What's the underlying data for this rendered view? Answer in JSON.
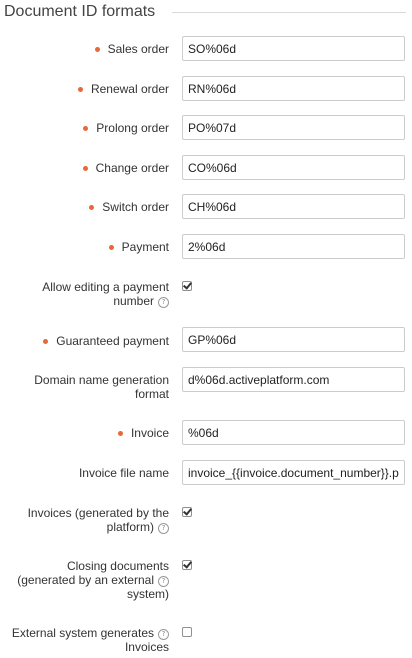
{
  "section": {
    "title": "Document ID formats"
  },
  "fields": {
    "sales_order": {
      "label": "Sales order",
      "value": "SO%06d"
    },
    "renewal_order": {
      "label": "Renewal order",
      "value": "RN%06d"
    },
    "prolong_order": {
      "label": "Prolong order",
      "value": "PO%07d"
    },
    "change_order": {
      "label": "Change order",
      "value": "CO%06d"
    },
    "switch_order": {
      "label": "Switch order",
      "value": "CH%06d"
    },
    "payment": {
      "label": "Payment",
      "value": "2%06d"
    },
    "allow_editing_payment_number": {
      "label_line1": "Allow editing a payment",
      "label_line2": "number",
      "checked": true
    },
    "guaranteed_payment": {
      "label": "Guaranteed payment",
      "value": "GP%06d"
    },
    "domain_name_generation_format": {
      "label_line1": "Domain name generation",
      "label_line2": "format",
      "value": "d%06d.activeplatform.com"
    },
    "invoice": {
      "label": "Invoice",
      "value": "%06d"
    },
    "invoice_file_name": {
      "label": "Invoice file name",
      "value": "invoice_{{invoice.document_number}}.pdf"
    },
    "invoices_generated_by_platform": {
      "label_line1": "Invoices (generated by the",
      "label_line2": "platform)",
      "checked": true
    },
    "closing_documents_external": {
      "label_line1": "Closing documents",
      "label_line2": "(generated by an external",
      "label_line3": "system)",
      "checked": true
    },
    "external_system_generates_invoices": {
      "label_line1": "External system generates",
      "label_line2": "Invoices",
      "checked": false
    }
  },
  "colors": {
    "required_marker": "#e8683a",
    "border": "#cccccc"
  },
  "icons": {
    "help": "question-circle-icon",
    "required": "required-dot-icon"
  }
}
